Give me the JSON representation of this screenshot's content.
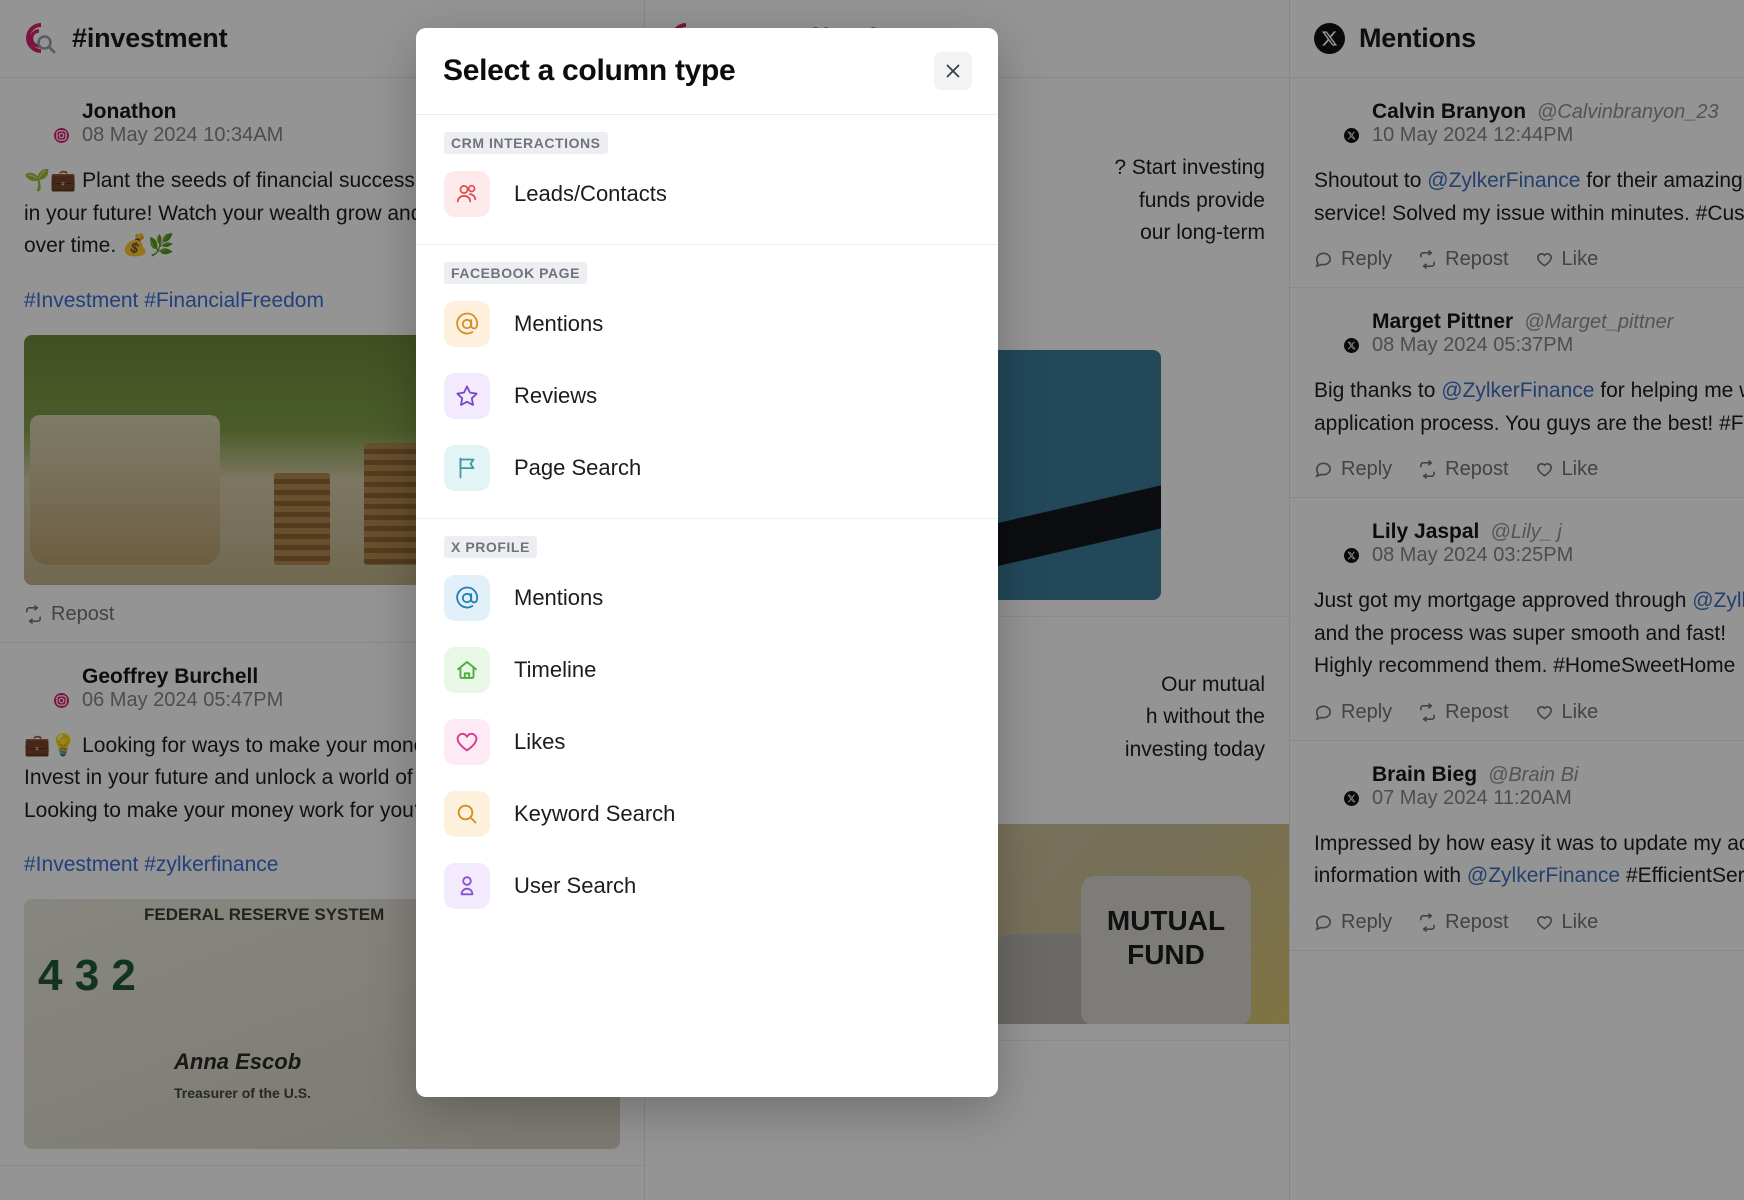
{
  "modal": {
    "title": "Select a column type",
    "close_label": "×",
    "groups": [
      {
        "label": "CRM INTERACTIONS",
        "options": [
          {
            "label": "Leads/Contacts",
            "icon": "leads-contacts-icon",
            "fg": "#e0474c",
            "bg": "#fdeaea"
          }
        ]
      },
      {
        "label": "FACEBOOK PAGE",
        "options": [
          {
            "label": "Mentions",
            "icon": "at-sign-icon",
            "fg": "#d98c2b",
            "bg": "#fdf0dc"
          },
          {
            "label": "Reviews",
            "icon": "star-icon",
            "fg": "#7a45c4",
            "bg": "#f3eafd"
          },
          {
            "label": "Page Search",
            "icon": "flag-icon",
            "fg": "#3f9aa6",
            "bg": "#e2f4f5"
          }
        ]
      },
      {
        "label": "X PROFILE",
        "options": [
          {
            "label": "Mentions",
            "icon": "at-sign-icon",
            "fg": "#1f7fb8",
            "bg": "#e2f0fa"
          },
          {
            "label": "Timeline",
            "icon": "home-icon",
            "fg": "#4caf3f",
            "bg": "#e9f7e7"
          },
          {
            "label": "Likes",
            "icon": "heart-icon",
            "fg": "#d63a8e",
            "bg": "#fdeaf4"
          },
          {
            "label": "Keyword Search",
            "icon": "magnifier-icon",
            "fg": "#d4901f",
            "bg": "#fdf1dd"
          },
          {
            "label": "User Search",
            "icon": "user-search-icon",
            "fg": "#8a4fd6",
            "bg": "#f3eafd"
          }
        ]
      }
    ]
  },
  "columns": [
    {
      "title": "#investment",
      "network": "instagram",
      "posts": [
        {
          "name": "Jonathon",
          "handle": "",
          "time": "08 May 2024 10:34AM",
          "lines": [
            "🌱💼 Plant the seeds of financial success today b",
            "in your future! Watch your wealth grow and flou",
            "over time. 💰🌿"
          ],
          "tags": "#Investment #FinancialFreedom",
          "media": "coins",
          "actions": [
            "Repost"
          ]
        },
        {
          "name": "Geoffrey Burchell",
          "handle": "",
          "time": "06 May 2024 05:47PM",
          "lines": [
            "💼💡 Looking for ways to make your money work",
            "Invest in your future and unlock a world of poss",
            "Looking to make your money work for you?"
          ],
          "tags": "#Investment #zylkerfinance",
          "media": "bill",
          "actions": []
        }
      ]
    },
    {
      "title": "#mutualfunds",
      "network": "instagram",
      "posts": [
        {
          "name": "",
          "handle": "",
          "time": "",
          "lines": [
            "? Start investing",
            "funds provide",
            "our long-term"
          ],
          "tags": "",
          "media": "blue",
          "actions": []
        },
        {
          "name": "",
          "handle": "",
          "time": "",
          "lines": [
            "Our mutual",
            "h without the",
            "investing today"
          ],
          "tags": "",
          "media": "mutual",
          "actions": []
        }
      ]
    }
  ],
  "mentions_column": {
    "title": "Mentions",
    "network": "x",
    "posts": [
      {
        "name": "Calvin Branyon",
        "handle": "@Calvinbranyon_23",
        "time": "10 May 2024 12:44PM",
        "lines_pre": [
          "Shoutout to "
        ],
        "mention": "@ZylkerFinance",
        "lines": [
          " for their amazing c",
          "service!  Solved my issue within minutes. #Cust"
        ],
        "actions": [
          "Reply",
          "Repost",
          "Like"
        ]
      },
      {
        "name": "Marget Pittner",
        "handle": "@Marget_pittner",
        "time": "08 May 2024 05:37PM",
        "lines_pre": [
          "Big thanks to "
        ],
        "mention": "@ZylkerFinance",
        "lines": [
          " for helping me wi",
          "application process. You guys are the best! #Fin"
        ],
        "actions": [
          "Reply",
          "Repost",
          "Like"
        ]
      },
      {
        "name": "Lily Jaspal",
        "handle": "@Lily_ j",
        "time": "08 May 2024 03:25PM",
        "lines_pre": [
          "Just got my mortgage approved through "
        ],
        "mention": "@Zylk",
        "lines": [
          "",
          "and the process was super smooth and fast!",
          "Highly recommend them. #HomeSweetHome"
        ],
        "actions": [
          "Reply",
          "Repost",
          "Like"
        ]
      },
      {
        "name": "Brain Bieg",
        "handle": "@Brain Bi",
        "time": "07 May 2024 11:20AM",
        "lines_pre": [
          "Impressed by how easy it was to update my acc"
        ],
        "mention": "",
        "lines": [
          "information with @ZylkerFinance #EfficientSer"
        ],
        "actions": [
          "Reply",
          "Repost",
          "Like"
        ]
      }
    ]
  },
  "icons": {
    "reply": "speech-bubble-icon",
    "repost": "repost-arrows-icon",
    "like": "heart-outline-icon"
  },
  "colors": {
    "brand_pink": "#d9216e",
    "x_black": "#121212",
    "link_blue": "#3d6fbe",
    "scrim": "rgba(0,0,0,0.42)"
  }
}
